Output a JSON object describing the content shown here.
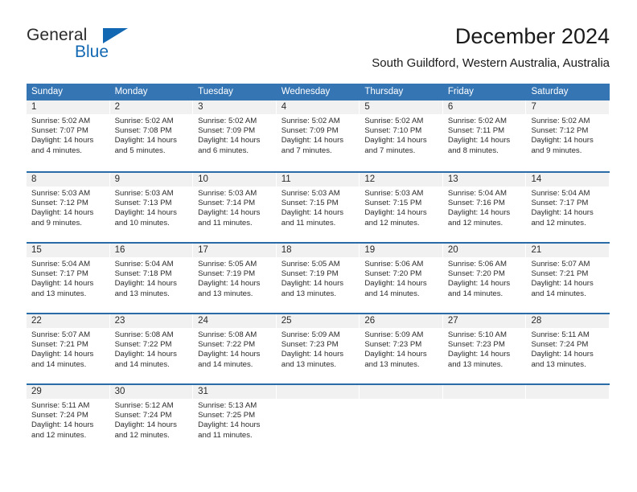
{
  "logo": {
    "word1": "General",
    "word2": "Blue",
    "triangle_color": "#1268b3",
    "text_color": "#2b2b2b"
  },
  "header": {
    "title": "December 2024",
    "subtitle": "South Guildford, Western Australia, Australia"
  },
  "theme": {
    "header_blue": "#3575b4",
    "row_divider_blue": "#2a6ca8",
    "day_band_gray": "#f1f1f1"
  },
  "weekdays": [
    "Sunday",
    "Monday",
    "Tuesday",
    "Wednesday",
    "Thursday",
    "Friday",
    "Saturday"
  ],
  "weeks": [
    [
      {
        "day": "1",
        "sunrise": "Sunrise: 5:02 AM",
        "sunset": "Sunset: 7:07 PM",
        "daylight1": "Daylight: 14 hours",
        "daylight2": "and 4 minutes."
      },
      {
        "day": "2",
        "sunrise": "Sunrise: 5:02 AM",
        "sunset": "Sunset: 7:08 PM",
        "daylight1": "Daylight: 14 hours",
        "daylight2": "and 5 minutes."
      },
      {
        "day": "3",
        "sunrise": "Sunrise: 5:02 AM",
        "sunset": "Sunset: 7:09 PM",
        "daylight1": "Daylight: 14 hours",
        "daylight2": "and 6 minutes."
      },
      {
        "day": "4",
        "sunrise": "Sunrise: 5:02 AM",
        "sunset": "Sunset: 7:09 PM",
        "daylight1": "Daylight: 14 hours",
        "daylight2": "and 7 minutes."
      },
      {
        "day": "5",
        "sunrise": "Sunrise: 5:02 AM",
        "sunset": "Sunset: 7:10 PM",
        "daylight1": "Daylight: 14 hours",
        "daylight2": "and 7 minutes."
      },
      {
        "day": "6",
        "sunrise": "Sunrise: 5:02 AM",
        "sunset": "Sunset: 7:11 PM",
        "daylight1": "Daylight: 14 hours",
        "daylight2": "and 8 minutes."
      },
      {
        "day": "7",
        "sunrise": "Sunrise: 5:02 AM",
        "sunset": "Sunset: 7:12 PM",
        "daylight1": "Daylight: 14 hours",
        "daylight2": "and 9 minutes."
      }
    ],
    [
      {
        "day": "8",
        "sunrise": "Sunrise: 5:03 AM",
        "sunset": "Sunset: 7:12 PM",
        "daylight1": "Daylight: 14 hours",
        "daylight2": "and 9 minutes."
      },
      {
        "day": "9",
        "sunrise": "Sunrise: 5:03 AM",
        "sunset": "Sunset: 7:13 PM",
        "daylight1": "Daylight: 14 hours",
        "daylight2": "and 10 minutes."
      },
      {
        "day": "10",
        "sunrise": "Sunrise: 5:03 AM",
        "sunset": "Sunset: 7:14 PM",
        "daylight1": "Daylight: 14 hours",
        "daylight2": "and 11 minutes."
      },
      {
        "day": "11",
        "sunrise": "Sunrise: 5:03 AM",
        "sunset": "Sunset: 7:15 PM",
        "daylight1": "Daylight: 14 hours",
        "daylight2": "and 11 minutes."
      },
      {
        "day": "12",
        "sunrise": "Sunrise: 5:03 AM",
        "sunset": "Sunset: 7:15 PM",
        "daylight1": "Daylight: 14 hours",
        "daylight2": "and 12 minutes."
      },
      {
        "day": "13",
        "sunrise": "Sunrise: 5:04 AM",
        "sunset": "Sunset: 7:16 PM",
        "daylight1": "Daylight: 14 hours",
        "daylight2": "and 12 minutes."
      },
      {
        "day": "14",
        "sunrise": "Sunrise: 5:04 AM",
        "sunset": "Sunset: 7:17 PM",
        "daylight1": "Daylight: 14 hours",
        "daylight2": "and 12 minutes."
      }
    ],
    [
      {
        "day": "15",
        "sunrise": "Sunrise: 5:04 AM",
        "sunset": "Sunset: 7:17 PM",
        "daylight1": "Daylight: 14 hours",
        "daylight2": "and 13 minutes."
      },
      {
        "day": "16",
        "sunrise": "Sunrise: 5:04 AM",
        "sunset": "Sunset: 7:18 PM",
        "daylight1": "Daylight: 14 hours",
        "daylight2": "and 13 minutes."
      },
      {
        "day": "17",
        "sunrise": "Sunrise: 5:05 AM",
        "sunset": "Sunset: 7:19 PM",
        "daylight1": "Daylight: 14 hours",
        "daylight2": "and 13 minutes."
      },
      {
        "day": "18",
        "sunrise": "Sunrise: 5:05 AM",
        "sunset": "Sunset: 7:19 PM",
        "daylight1": "Daylight: 14 hours",
        "daylight2": "and 13 minutes."
      },
      {
        "day": "19",
        "sunrise": "Sunrise: 5:06 AM",
        "sunset": "Sunset: 7:20 PM",
        "daylight1": "Daylight: 14 hours",
        "daylight2": "and 14 minutes."
      },
      {
        "day": "20",
        "sunrise": "Sunrise: 5:06 AM",
        "sunset": "Sunset: 7:20 PM",
        "daylight1": "Daylight: 14 hours",
        "daylight2": "and 14 minutes."
      },
      {
        "day": "21",
        "sunrise": "Sunrise: 5:07 AM",
        "sunset": "Sunset: 7:21 PM",
        "daylight1": "Daylight: 14 hours",
        "daylight2": "and 14 minutes."
      }
    ],
    [
      {
        "day": "22",
        "sunrise": "Sunrise: 5:07 AM",
        "sunset": "Sunset: 7:21 PM",
        "daylight1": "Daylight: 14 hours",
        "daylight2": "and 14 minutes."
      },
      {
        "day": "23",
        "sunrise": "Sunrise: 5:08 AM",
        "sunset": "Sunset: 7:22 PM",
        "daylight1": "Daylight: 14 hours",
        "daylight2": "and 14 minutes."
      },
      {
        "day": "24",
        "sunrise": "Sunrise: 5:08 AM",
        "sunset": "Sunset: 7:22 PM",
        "daylight1": "Daylight: 14 hours",
        "daylight2": "and 14 minutes."
      },
      {
        "day": "25",
        "sunrise": "Sunrise: 5:09 AM",
        "sunset": "Sunset: 7:23 PM",
        "daylight1": "Daylight: 14 hours",
        "daylight2": "and 13 minutes."
      },
      {
        "day": "26",
        "sunrise": "Sunrise: 5:09 AM",
        "sunset": "Sunset: 7:23 PM",
        "daylight1": "Daylight: 14 hours",
        "daylight2": "and 13 minutes."
      },
      {
        "day": "27",
        "sunrise": "Sunrise: 5:10 AM",
        "sunset": "Sunset: 7:23 PM",
        "daylight1": "Daylight: 14 hours",
        "daylight2": "and 13 minutes."
      },
      {
        "day": "28",
        "sunrise": "Sunrise: 5:11 AM",
        "sunset": "Sunset: 7:24 PM",
        "daylight1": "Daylight: 14 hours",
        "daylight2": "and 13 minutes."
      }
    ],
    [
      {
        "day": "29",
        "sunrise": "Sunrise: 5:11 AM",
        "sunset": "Sunset: 7:24 PM",
        "daylight1": "Daylight: 14 hours",
        "daylight2": "and 12 minutes."
      },
      {
        "day": "30",
        "sunrise": "Sunrise: 5:12 AM",
        "sunset": "Sunset: 7:24 PM",
        "daylight1": "Daylight: 14 hours",
        "daylight2": "and 12 minutes."
      },
      {
        "day": "31",
        "sunrise": "Sunrise: 5:13 AM",
        "sunset": "Sunset: 7:25 PM",
        "daylight1": "Daylight: 14 hours",
        "daylight2": "and 11 minutes."
      },
      {
        "day": "",
        "sunrise": "",
        "sunset": "",
        "daylight1": "",
        "daylight2": ""
      },
      {
        "day": "",
        "sunrise": "",
        "sunset": "",
        "daylight1": "",
        "daylight2": ""
      },
      {
        "day": "",
        "sunrise": "",
        "sunset": "",
        "daylight1": "",
        "daylight2": ""
      },
      {
        "day": "",
        "sunrise": "",
        "sunset": "",
        "daylight1": "",
        "daylight2": ""
      }
    ]
  ]
}
